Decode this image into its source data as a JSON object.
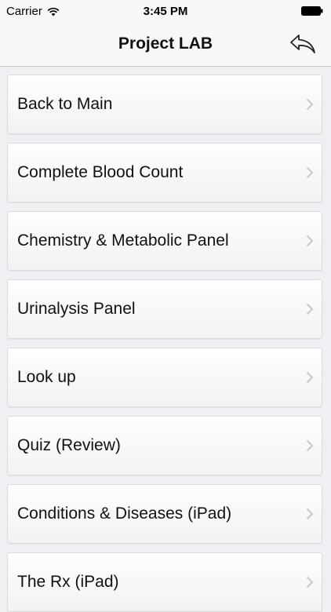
{
  "status_bar": {
    "carrier": "Carrier",
    "time": "3:45 PM",
    "icons": [
      "wifi-icon",
      "battery-icon"
    ]
  },
  "nav": {
    "title": "Project LAB",
    "back_icon": "reply-arrow-icon"
  },
  "menu": {
    "items": [
      {
        "label": "Back to Main"
      },
      {
        "label": "Complete Blood Count"
      },
      {
        "label": "Chemistry & Metabolic Panel"
      },
      {
        "label": "Urinalysis Panel"
      },
      {
        "label": "Look up"
      },
      {
        "label": "Quiz (Review)"
      },
      {
        "label": "Conditions & Diseases (iPad)"
      },
      {
        "label": "The Rx (iPad)"
      }
    ]
  },
  "colors": {
    "background": "#efeff4",
    "chevron": "#c7c7cc"
  }
}
